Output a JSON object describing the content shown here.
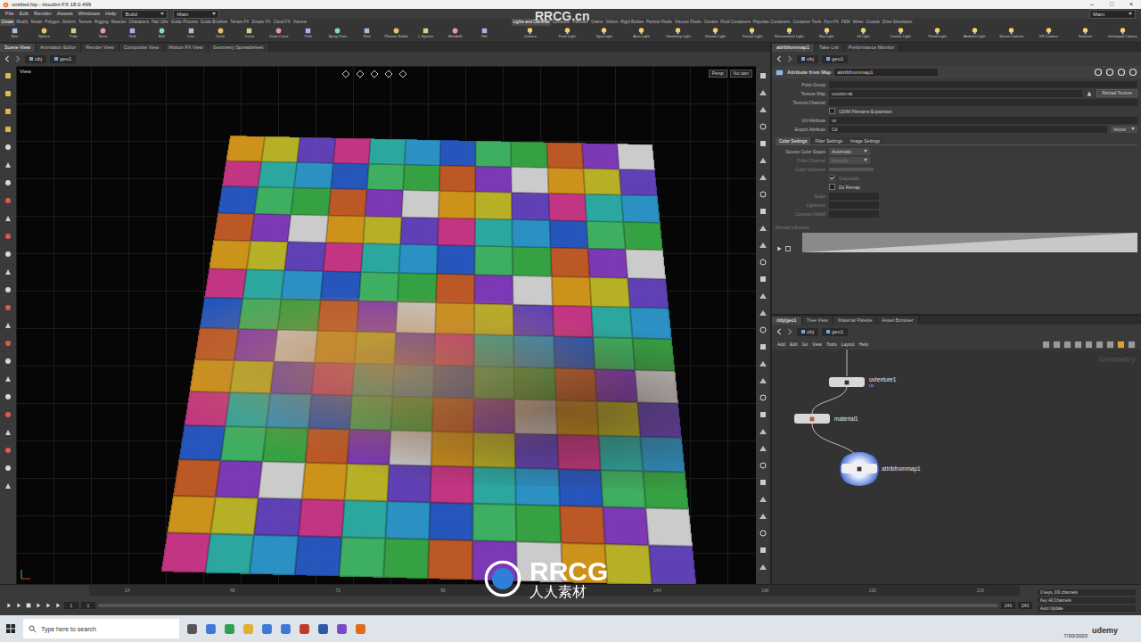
{
  "window": {
    "title": "untitled.hip - Houdini FX 18.0.499",
    "controls": [
      "–",
      "□",
      "×"
    ]
  },
  "menu": [
    "File",
    "Edit",
    "Render",
    "Assets",
    "Windows",
    "Help"
  ],
  "desktop": "Build",
  "shelf_set": "Main",
  "desktop_right": "Main",
  "shelf_left": {
    "tabs": [
      {
        "label": "Create",
        "selected": true
      },
      {
        "label": "Modify",
        "selected": false
      },
      {
        "label": "Model",
        "selected": false
      },
      {
        "label": "Polygon",
        "selected": false
      },
      {
        "label": "Deform",
        "selected": false
      },
      {
        "label": "Texture",
        "selected": false
      },
      {
        "label": "Rigging",
        "selected": false
      },
      {
        "label": "Muscles",
        "selected": false
      },
      {
        "label": "Characters",
        "selected": false
      },
      {
        "label": "Hair Utils",
        "selected": false
      },
      {
        "label": "Guide Process",
        "selected": false
      },
      {
        "label": "Guide Brushes",
        "selected": false
      },
      {
        "label": "Terrain FX",
        "selected": false
      },
      {
        "label": "Simple FX",
        "selected": false
      },
      {
        "label": "Cloud FX",
        "selected": false
      },
      {
        "label": "Volume",
        "selected": false
      }
    ],
    "tools": [
      "Box",
      "Sphere",
      "Tube",
      "Torus",
      "Grid",
      "Null",
      "Line",
      "Circle",
      "Curve",
      "Draw Curve",
      "Path",
      "Spray Paint",
      "Font",
      "Platonic Solids",
      "L-System",
      "Metaball",
      "File"
    ]
  },
  "shelf_right": {
    "tabs": [
      {
        "label": "Lights and Cameras",
        "selected": true
      },
      {
        "label": "Collisions",
        "selected": false
      },
      {
        "label": "Particles",
        "selected": false
      },
      {
        "label": "Grains",
        "selected": false
      },
      {
        "label": "Vellum",
        "selected": false
      },
      {
        "label": "Rigid Bodies",
        "selected": false
      },
      {
        "label": "Particle Fluids",
        "selected": false
      },
      {
        "label": "Viscous Fluids",
        "selected": false
      },
      {
        "label": "Oceans",
        "selected": false
      },
      {
        "label": "Fluid Containers",
        "selected": false
      },
      {
        "label": "Populate Containers",
        "selected": false
      },
      {
        "label": "Container Tools",
        "selected": false
      },
      {
        "label": "Pyro FX",
        "selected": false
      },
      {
        "label": "FEM",
        "selected": false
      },
      {
        "label": "Wires",
        "selected": false
      },
      {
        "label": "Crowds",
        "selected": false
      },
      {
        "label": "Drive Simulation",
        "selected": false
      }
    ],
    "tools": [
      "Camera",
      "Point Light",
      "Spot Light",
      "Area Light",
      "Geometry Light",
      "Volume Light",
      "Distant Light",
      "Environment Light",
      "Sky Light",
      "GI Light",
      "Caustic Light",
      "Portal Light",
      "Ambient Light",
      "Stereo Camera",
      "VR Camera",
      "Switcher",
      "Gamepad Camera"
    ]
  },
  "pane_tabs": [
    {
      "label": "Scene View",
      "selected": true
    },
    {
      "label": "Animation Editor",
      "selected": false
    },
    {
      "label": "Render View",
      "selected": false
    },
    {
      "label": "Composite View",
      "selected": false
    },
    {
      "label": "Motion FX View",
      "selected": false
    },
    {
      "label": "Geometry Spreadsheet",
      "selected": false
    }
  ],
  "scene_path": [
    "obj",
    "geo1"
  ],
  "viewport": {
    "label": "View",
    "camera": "Persp",
    "cam_menu": "No cam"
  },
  "param_tabs": [
    {
      "label": "attribfrommap1",
      "selected": true
    },
    {
      "label": "Take List",
      "selected": false
    },
    {
      "label": "Performance Monitor",
      "selected": false
    }
  ],
  "param_path": [
    "obj",
    "geo1"
  ],
  "node_header": {
    "type": "Attribute from Map",
    "name": "attribfrommap1"
  },
  "params": [
    {
      "label": "Point Group",
      "kind": "field",
      "value": ""
    },
    {
      "label": "Texture Map",
      "kind": "file",
      "value": "uvcolor.rat",
      "button": "Reload Texture"
    },
    {
      "label": "Texture Channel",
      "kind": "field",
      "value": ""
    },
    {
      "label": "UDIM Filename Expansion",
      "kind": "toggle",
      "checked": false
    },
    {
      "label": "UV Attribute",
      "kind": "field",
      "value": "uv"
    },
    {
      "label": "Export Attribute",
      "kind": "menu-field",
      "value": "Cd",
      "menu": "Vector"
    }
  ],
  "settings_tabs": [
    {
      "label": "Color Settings",
      "selected": true
    },
    {
      "label": "Filter Settings",
      "selected": false
    },
    {
      "label": "Image Settings",
      "selected": false
    }
  ],
  "color_params": [
    {
      "label": "Source Color Space",
      "kind": "menu",
      "value": "Automatic",
      "disabled": false
    },
    {
      "label": "Color Channel",
      "kind": "menu",
      "value": "Intensity",
      "disabled": true
    },
    {
      "label": "Color Influence",
      "kind": "slider",
      "level": 1,
      "disabled": true
    },
    {
      "label": "Grayscale",
      "kind": "toggle",
      "checked": true,
      "disabled": true
    },
    {
      "label": "Do Remap",
      "kind": "toggle",
      "checked": false,
      "disabled": false
    },
    {
      "label": "Scale",
      "kind": "field",
      "value": "",
      "disabled": true
    },
    {
      "label": "Lightness",
      "kind": "field",
      "value": "",
      "disabled": true
    },
    {
      "label": "Contrast Falloff",
      "kind": "field",
      "value": "",
      "disabled": true
    }
  ],
  "ramp": {
    "label": "Remap Influence"
  },
  "network_tabs": [
    {
      "label": "/obj/geo1",
      "selected": true
    },
    {
      "label": "Tree View",
      "selected": false
    },
    {
      "label": "Material Palette",
      "selected": false
    },
    {
      "label": "Asset Browser",
      "selected": false
    }
  ],
  "network_path": [
    "obj",
    "geo1"
  ],
  "network_menu": [
    "Add",
    "Edit",
    "Go",
    "View",
    "Tools",
    "Layout",
    "Help"
  ],
  "network_context": "Geometry",
  "nodes": [
    {
      "name": "uvtexture1",
      "sub": "uv",
      "selected": false
    },
    {
      "name": "material1",
      "sub": "",
      "selected": false
    },
    {
      "name": "attribfrommap1",
      "sub": "",
      "selected": true
    }
  ],
  "timeline": {
    "frame": "1",
    "start": "1",
    "ticks": [
      "24",
      "48",
      "72",
      "96",
      "120",
      "144",
      "168",
      "192",
      "216"
    ],
    "end_a": "240",
    "end_b": "240",
    "keys": "0 keys, 0/0 channels",
    "key_all": "Key All Channels",
    "auto_update": "Auto Update"
  },
  "taskbar": {
    "search": "Type here to search",
    "date": "7/30/2020"
  },
  "watermarks": {
    "top": "RRCG.cn",
    "logo": "RRCG",
    "logo_sub": "人人素材",
    "udemy": "udemy"
  }
}
